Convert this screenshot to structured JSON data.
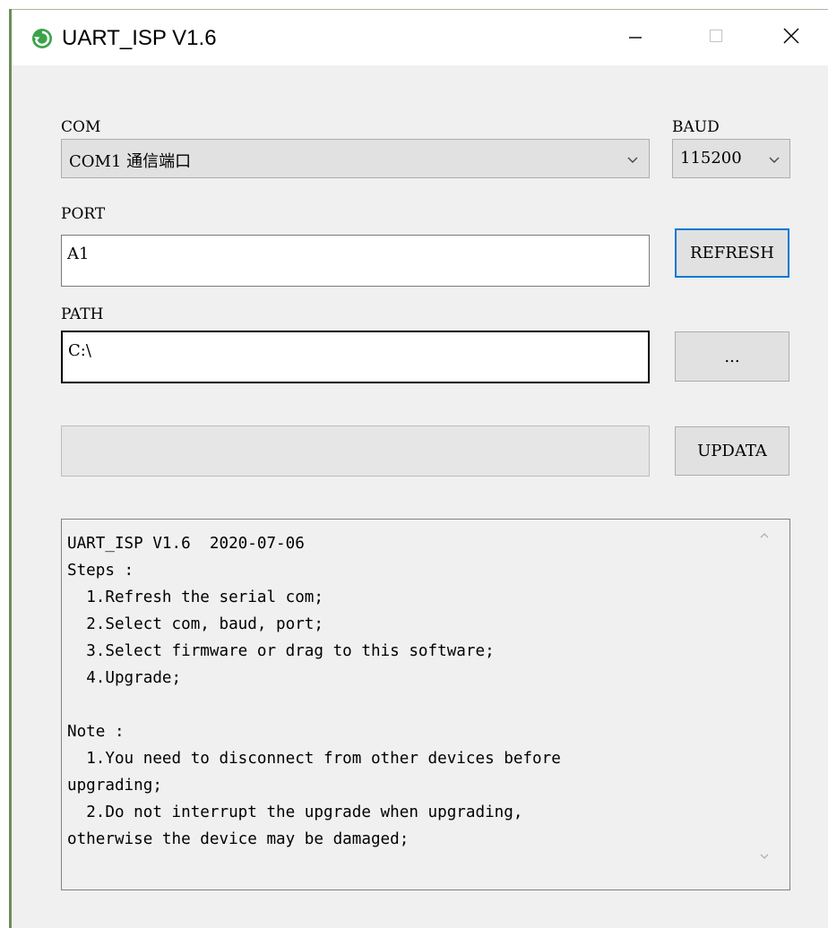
{
  "window": {
    "title": "UART_ISP V1.6",
    "accent_color": "#0078d7",
    "icon_color": "#3aa34a"
  },
  "com": {
    "label": "COM",
    "selected": "COM1 通信端口"
  },
  "baud": {
    "label": "BAUD",
    "selected": "115200"
  },
  "port": {
    "label": "PORT",
    "value": "A1"
  },
  "path": {
    "label": "PATH",
    "value": "C:\\"
  },
  "buttons": {
    "refresh": "REFRESH",
    "browse": "...",
    "update": "UPDATA"
  },
  "progress": {
    "percent": 0
  },
  "log": {
    "text": "UART_ISP V1.6  2020-07-06\nSteps :\n  1.Refresh the serial com;\n  2.Select com, baud, port;\n  3.Select firmware or drag to this software;\n  4.Upgrade;\n\nNote :\n  1.You need to disconnect from other devices before\nupgrading;\n  2.Do not interrupt the upgrade when upgrading,\notherwise the device may be damaged;"
  }
}
